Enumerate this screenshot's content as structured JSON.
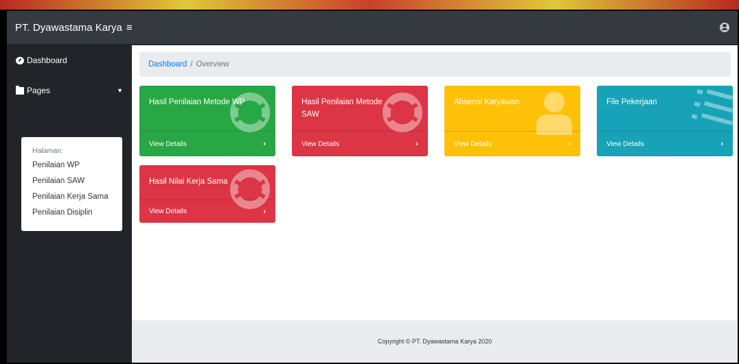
{
  "topbar": {
    "brand": "PT. Dyawastama Karya",
    "toggle_glyph": "≡",
    "user_icon": "user-circle-icon"
  },
  "sidebar": {
    "items": [
      {
        "label": "Dashboard",
        "icon": "dashboard-icon"
      },
      {
        "label": "Pages",
        "icon": "folder-icon"
      }
    ],
    "submenu": {
      "header": "Halaman:",
      "items": [
        "Penilaian WP",
        "Penilaian SAW",
        "Penilaian Kerja Sama",
        "Penilaian Disiplin"
      ]
    }
  },
  "breadcrumb": {
    "link": "Dashboard",
    "separator": "/",
    "current": "Overview"
  },
  "cards": [
    {
      "title": "Hasil Penilaian Metode WP",
      "footer": "View Details",
      "arrow": "›",
      "color": "#28a745",
      "icon": "life-ring-icon"
    },
    {
      "title": "Hasil Penilaian Metode SAW",
      "footer": "View Details",
      "arrow": "›",
      "color": "#dc3545",
      "icon": "life-ring-icon"
    },
    {
      "title": "Absensi Karyawan",
      "footer": "View Details",
      "arrow": "›",
      "color": "#ffc107",
      "icon": "user-icon"
    },
    {
      "title": "File Pekerjaan",
      "footer": "View Details",
      "arrow": "›",
      "color": "#17a2b8",
      "icon": "list-icon"
    },
    {
      "title": "Hasil Nilai Kerja Sama",
      "footer": "View Details",
      "arrow": "›",
      "color": "#dc3545",
      "icon": "life-ring-icon"
    }
  ],
  "footer": {
    "copyright": "Copyright © PT. Dyawastama Karya 2020"
  }
}
